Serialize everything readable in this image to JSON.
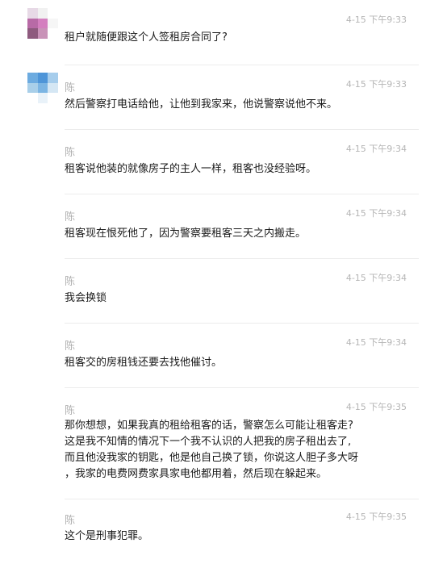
{
  "messages": [
    {
      "name": "",
      "time": "4-15 下午9:33",
      "text": "租户就随便跟这个人签租房合同了?"
    },
    {
      "name": "陈",
      "time": "4-15 下午9:33",
      "text": "然后警察打电话给他，让他到我家来，他说警察说他不来。"
    },
    {
      "name": "陈",
      "time": "4-15 下午9:34",
      "text": "租客说他装的就像房子的主人一样，租客也没经验呀。"
    },
    {
      "name": "陈",
      "time": "4-15 下午9:34",
      "text": "租客现在恨死他了，因为警察要租客三天之内搬走。"
    },
    {
      "name": "陈",
      "time": "4-15 下午9:34",
      "text": "我会换锁"
    },
    {
      "name": "陈",
      "time": "4-15 下午9:34",
      "text": "租客交的房租钱还要去找他催讨。"
    },
    {
      "name": "陈",
      "time": "4-15 下午9:35",
      "lines": [
        "那你想想，如果我真的租给租客的话，警察怎么可能让租客走?",
        "这是我不知情的情况下一个我不认识的人把我的房子租出去了,",
        "而且他没我家的钥匙，他是他自己换了锁，你说这人胆子多大呀",
        "，我家的电费网费家具家电他都用着，然后现在躲起来。"
      ]
    },
    {
      "name": "陈",
      "time": "4-15 下午9:35",
      "text": "这个是刑事犯罪。"
    }
  ],
  "avatars": {
    "other": [
      "#e7d9e6",
      "#f1f1f1",
      "#ffffff",
      "#b86aa6",
      "#d47fbf",
      "#f6f6f6",
      "#8e5a7e",
      "#c993b8",
      "#ffffff"
    ],
    "chen": [
      "#6cabe0",
      "#4e95d8",
      "#a6cdec",
      "#a9cfe9",
      "#7cb5e3",
      "#d5e7f4",
      "#ffffff",
      "#e9f2f9",
      "#ffffff"
    ]
  }
}
